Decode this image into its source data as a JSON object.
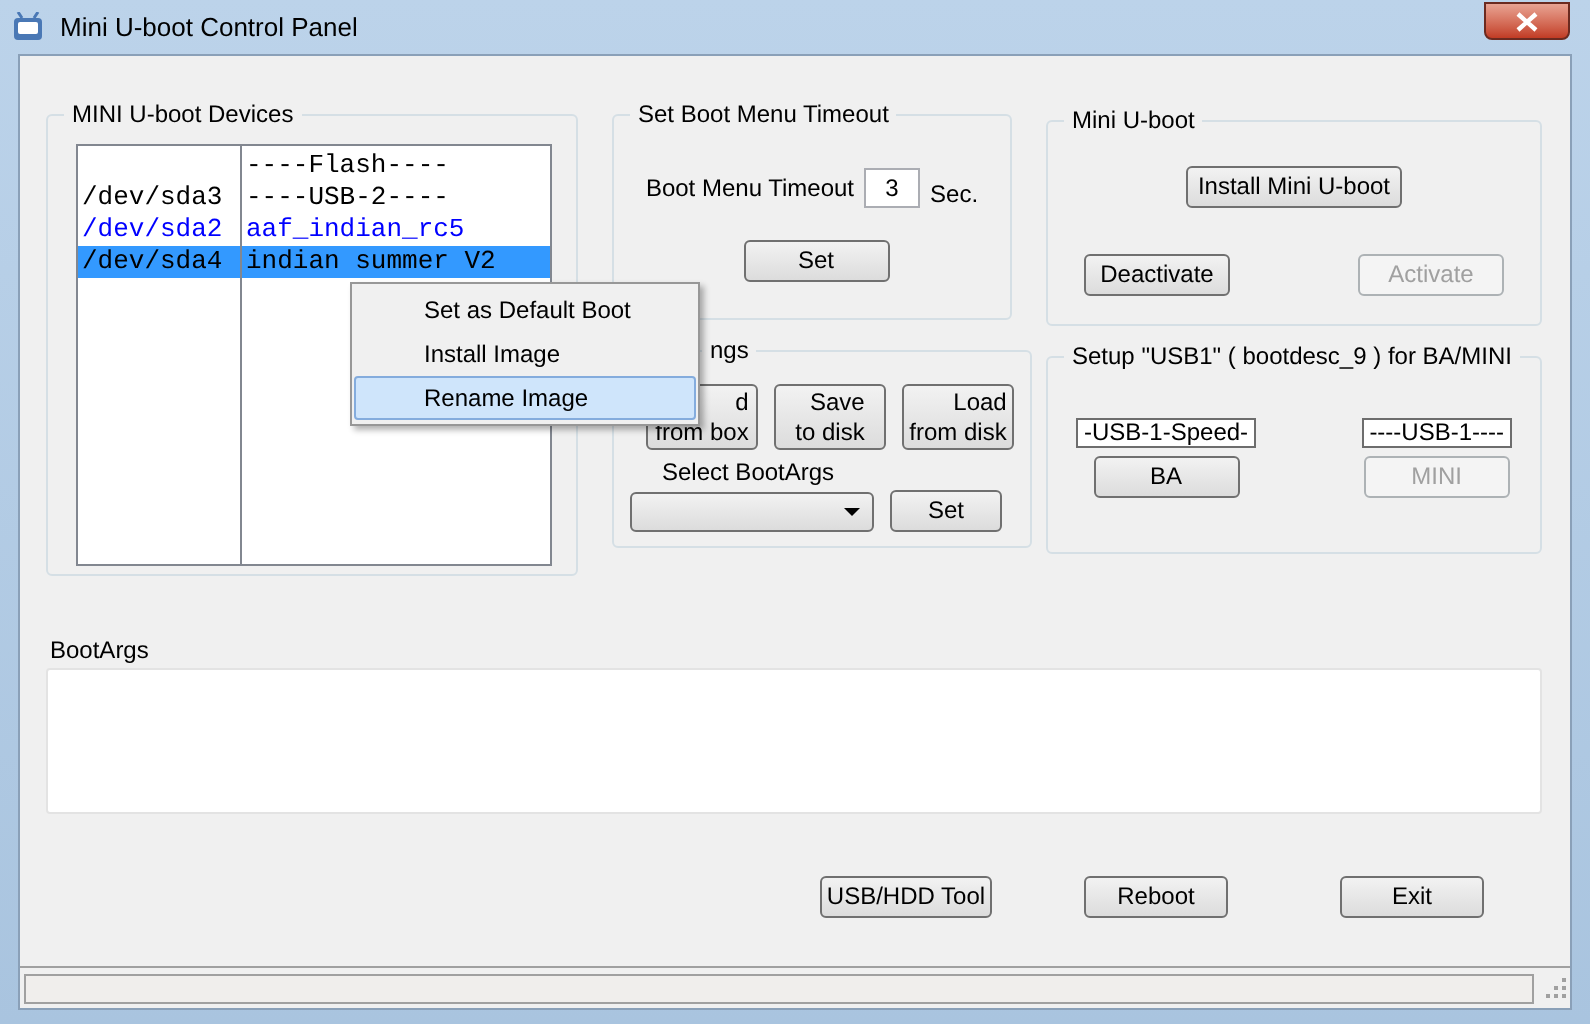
{
  "window": {
    "title": "Mini U-boot Control Panel"
  },
  "devices_group": {
    "title": "MINI U-boot Devices",
    "rows": [
      {
        "image": "----Flash----",
        "color": "#000000",
        "selected": false
      },
      {
        "device": "/dev/sda3",
        "image": "----USB-2----",
        "color": "#000000",
        "selected": false
      },
      {
        "device": "/dev/sda2",
        "image": "aaf_indian_rc5",
        "color": "#0000ff",
        "selected": false
      },
      {
        "device": "/dev/sda4",
        "image": "indian summer V2",
        "color": "#000000",
        "selected": true
      }
    ]
  },
  "context_menu": {
    "items": [
      {
        "label": "Set as Default Boot",
        "selected": false
      },
      {
        "label": "Install Image",
        "selected": false
      },
      {
        "label": "Rename Image",
        "selected": true
      }
    ]
  },
  "timeout_group": {
    "title": "Set Boot Menu Timeout",
    "label": "Boot Menu Timeout",
    "value": "3",
    "unit": "Sec.",
    "button": "Set"
  },
  "settings_group": {
    "title": "ngs",
    "buttons": [
      {
        "lines": [
          "d",
          "from box"
        ]
      },
      {
        "lines": [
          "Save",
          "to disk"
        ]
      },
      {
        "lines": [
          "Load",
          "from disk"
        ]
      }
    ],
    "select_label": "Select BootArgs",
    "button": "Set"
  },
  "mini_uboot_group": {
    "title": "Mini U-boot",
    "install_button": "Install Mini U-boot",
    "buttons": [
      {
        "label": "Deactivate",
        "disabled": false
      },
      {
        "label": "Activate",
        "disabled": true
      }
    ]
  },
  "usb_group": {
    "title": "Setup \"USB1\" ( bootdesc_9 ) for BA/MINI",
    "columns": [
      {
        "field": "-USB-1-Speed-",
        "button": "BA",
        "disabled": false
      },
      {
        "field": "----USB-1----",
        "button": "MINI",
        "disabled": true
      }
    ]
  },
  "bootargs": {
    "label": "BootArgs"
  },
  "buttons": [
    "USB/HDD Tool",
    "Reboot",
    "Exit"
  ]
}
